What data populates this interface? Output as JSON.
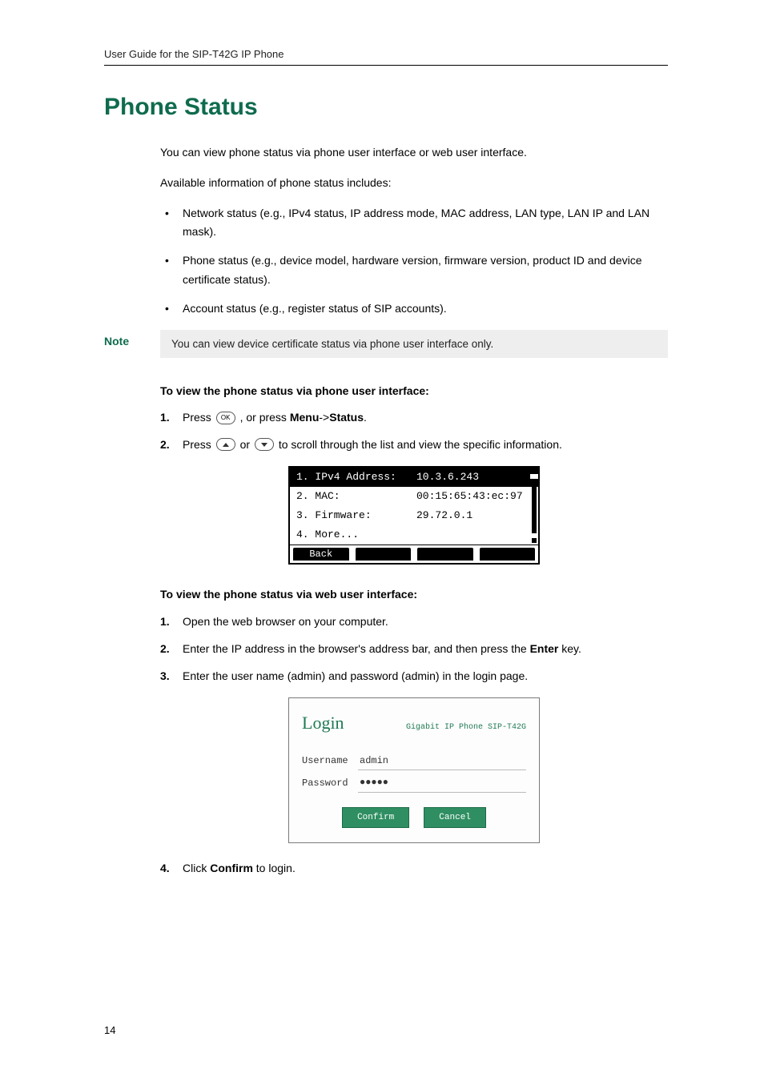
{
  "header": "User Guide for the SIP-T42G IP Phone",
  "title": "Phone Status",
  "intro1": "You can view phone status via phone user interface or web user interface.",
  "intro2": "Available information of phone status includes:",
  "bullets": [
    "Network status (e.g., IPv4 status, IP address mode, MAC address, LAN type, LAN IP and LAN mask).",
    "Phone status (e.g., device model, hardware version, firmware version, product ID and device certificate status).",
    "Account status (e.g., register status of SIP accounts)."
  ],
  "note_label": "Note",
  "note_text": "You can view device certificate status via phone user interface only.",
  "proc1_title": "To view the phone status via phone user interface:",
  "proc1": {
    "s1_a": "Press ",
    "s1_ok": "OK",
    "s1_b": " , or press ",
    "s1_menu": "Menu",
    "s1_arrow": "->",
    "s1_status": "Status",
    "s1_c": ".",
    "s2_a": "Press ",
    "s2_b": " or ",
    "s2_c": " to scroll through the list and view the specific information."
  },
  "lcd": {
    "r1_label": "1. IPv4 Address:",
    "r1_val": "10.3.6.243",
    "r2_label": "2. MAC:",
    "r2_val": "00:15:65:43:ec:97",
    "r3_label": "3. Firmware:",
    "r3_val": "29.72.0.1",
    "r4_label": "4. More...",
    "soft1": "Back"
  },
  "proc2_title": "To view the phone status via web user interface:",
  "proc2": {
    "s1": "Open the web browser on your computer.",
    "s2_a": "Enter the IP address in the browser's address bar, and then press the ",
    "s2_key": "Enter",
    "s2_b": " key.",
    "s3": "Enter the user name (admin) and password (admin) in the login page.",
    "s4_a": "Click ",
    "s4_btn": "Confirm",
    "s4_b": " to login."
  },
  "login": {
    "title": "Login",
    "model": "Gigabit IP Phone SIP-T42G",
    "user_lbl": "Username",
    "user_val": "admin",
    "pass_lbl": "Password",
    "pass_val": "●●●●●",
    "confirm": "Confirm",
    "cancel": "Cancel"
  },
  "page_number": "14"
}
